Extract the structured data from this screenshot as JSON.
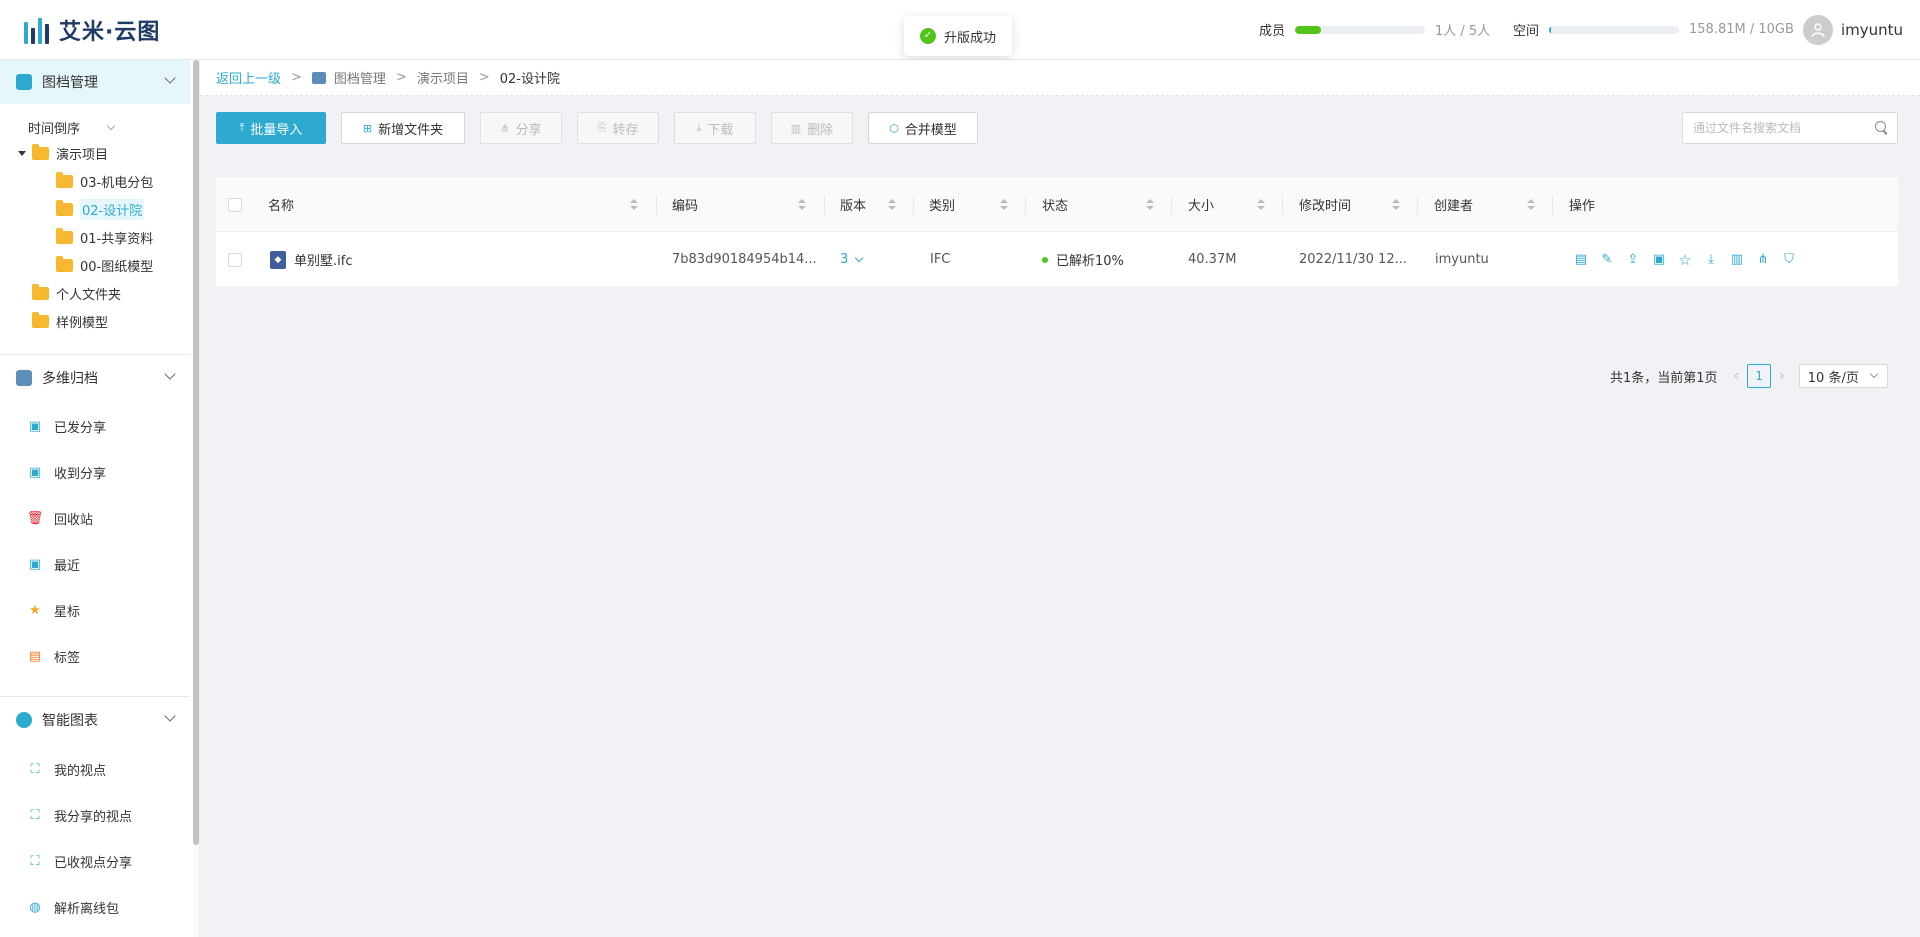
{
  "app": {
    "logo_text": "艾米·云图"
  },
  "toast": {
    "message": "升版成功"
  },
  "header": {
    "members": {
      "label": "成员",
      "value_text": "1人 / 5人",
      "fraction": 0.2,
      "color": "#52c41a"
    },
    "space": {
      "label": "空间",
      "value_text": "158.81M / 10GB",
      "fraction": 0.016,
      "color": "#2eaad1"
    },
    "user": {
      "name": "imyuntu"
    }
  },
  "sidebar": {
    "sections": [
      {
        "label": "图档管理",
        "icon": "archive-icon"
      },
      {
        "label": "多维归档",
        "icon": "folders-icon"
      },
      {
        "label": "智能图表",
        "icon": "chart-icon"
      }
    ],
    "sort_label": "时间倒序",
    "tree": [
      {
        "label": "演示项目",
        "expanded": true
      },
      {
        "label": "03-机电分包"
      },
      {
        "label": "02-设计院",
        "selected": true
      },
      {
        "label": "01-共享资料"
      },
      {
        "label": "00-图纸模型"
      },
      {
        "label": "个人文件夹"
      },
      {
        "label": "样例模型"
      }
    ],
    "archive_items": [
      {
        "label": "已发分享",
        "icon": "share-out-icon"
      },
      {
        "label": "收到分享",
        "icon": "share-in-icon"
      },
      {
        "label": "回收站",
        "icon": "trash-icon"
      },
      {
        "label": "最近",
        "icon": "recent-icon"
      },
      {
        "label": "星标",
        "icon": "star-icon"
      },
      {
        "label": "标签",
        "icon": "tag-icon"
      }
    ],
    "chart_items": [
      {
        "label": "我的视点",
        "icon": "viewpoint-icon"
      },
      {
        "label": "我分享的视点",
        "icon": "viewpoint-icon"
      },
      {
        "label": "已收视点分享",
        "icon": "viewpoint-icon"
      },
      {
        "label": "解析离线包",
        "icon": "globe-icon"
      }
    ]
  },
  "breadcrumb": {
    "back": "返回上一级",
    "items": [
      "图档管理",
      "演示项目",
      "02-设计院"
    ]
  },
  "toolbar": {
    "import": "批量导入",
    "new_folder": "新增文件夹",
    "share": "分享",
    "transfer": "转存",
    "download": "下载",
    "delete": "删除",
    "merge": "合并模型",
    "search_placeholder": "通过文件名搜索文档"
  },
  "table": {
    "columns": [
      "名称",
      "编码",
      "版本",
      "类别",
      "状态",
      "大小",
      "修改时间",
      "创建者",
      "操作"
    ],
    "rows": [
      {
        "name": "单别墅.ifc",
        "code": "7b83d90184954b14...",
        "version": "3",
        "category": "IFC",
        "status": "已解析10%",
        "size": "40.37M",
        "modified": "2022/11/30 12...",
        "creator": "imyuntu"
      }
    ]
  },
  "pagination": {
    "summary": "共1条，当前第1页",
    "current": "1",
    "page_size": "10 条/页"
  },
  "colors": {
    "accent": "#2eaad1",
    "success": "#52c41a",
    "folder": "#f5b82e"
  }
}
